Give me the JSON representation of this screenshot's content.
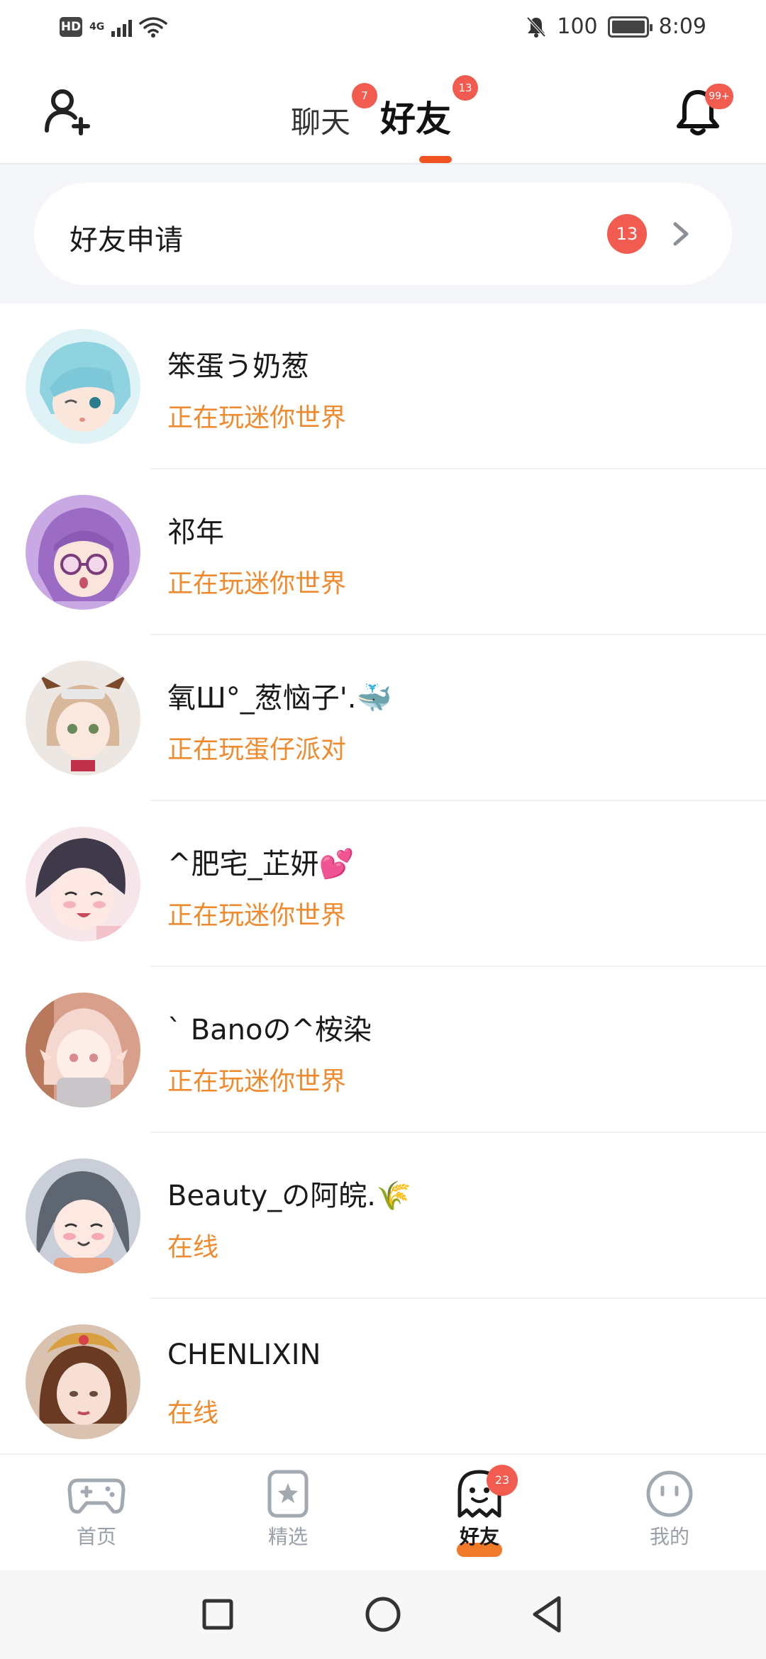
{
  "status_bar": {
    "hd_label": "HD",
    "network": "4G",
    "battery_text": "100",
    "time": "8:09"
  },
  "header": {
    "tabs": [
      {
        "label": "聊天",
        "badge": "7",
        "active": false
      },
      {
        "label": "好友",
        "badge": "13",
        "active": true
      }
    ],
    "notification_badge": "99+"
  },
  "friend_request": {
    "label": "好友申请",
    "count": "13"
  },
  "friends": [
    {
      "name": "笨蛋う奶葱",
      "status": "正在玩迷你世界",
      "avatar_color": "#a8dde6"
    },
    {
      "name": "祁年",
      "status": "正在玩迷你世界",
      "avatar_color": "#b993d6"
    },
    {
      "name": "氧Ш°_葱恼子'.🐳",
      "status": "正在玩蛋仔派对",
      "avatar_color": "#e9e2da"
    },
    {
      "name": "^肥宅_芷妍💕",
      "status": "正在玩迷你世界",
      "avatar_color": "#f2d8de"
    },
    {
      "name": "` Banoの^桉染",
      "status": "正在玩迷你世界",
      "avatar_color": "#e7b7a8"
    },
    {
      "name": "Beauty_の阿皖.🌾",
      "status": "在线",
      "avatar_color": "#b7bfcc"
    },
    {
      "name": "CHENLIXIN",
      "status": "在线",
      "avatar_color": "#c99a7e"
    }
  ],
  "bottom_nav": [
    {
      "label": "首页",
      "icon": "gamepad-icon",
      "active": false
    },
    {
      "label": "精选",
      "icon": "star-bookmark-icon",
      "active": false
    },
    {
      "label": "好友",
      "icon": "ghost-icon",
      "active": true,
      "badge": "23"
    },
    {
      "label": "我的",
      "icon": "smiley-icon",
      "active": false
    }
  ],
  "colors": {
    "accent": "#f0531f",
    "badge": "#f25b4f",
    "status_orange": "#ef8a2f",
    "band_bg": "#f4f6f9"
  }
}
